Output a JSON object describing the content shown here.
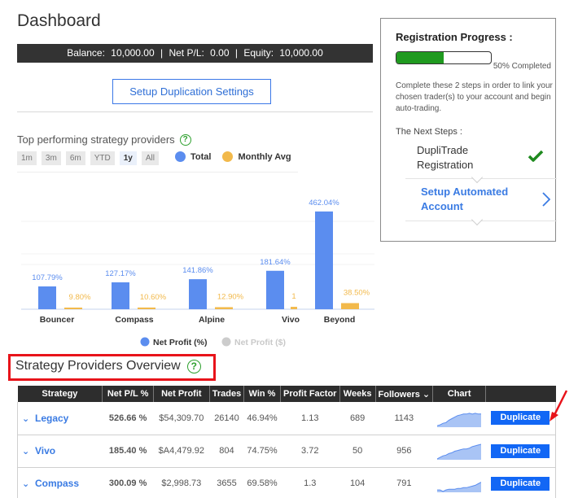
{
  "header": {
    "title": "Dashboard"
  },
  "balance_bar": {
    "balance_label": "Balance:",
    "balance_value": "10,000.00",
    "netpl_label": "Net P/L:",
    "netpl_value": "0.00",
    "equity_label": "Equity:",
    "equity_value": "10,000.00",
    "separator": "|"
  },
  "setup_button": {
    "label": "Setup Duplication Settings"
  },
  "top_providers": {
    "title": "Top performing strategy providers",
    "help_icon": "?",
    "ranges": [
      "1m",
      "3m",
      "6m",
      "YTD",
      "1y",
      "All"
    ],
    "active_range": "1y",
    "metric_legend": [
      {
        "label": "Total",
        "color": "#5b8def"
      },
      {
        "label": "Monthly Avg",
        "color": "#f2b94b"
      }
    ]
  },
  "chart_data": {
    "type": "bar",
    "title": "Top performing strategy providers",
    "categories": [
      "Bouncer",
      "Compass",
      "Alpine",
      "Vivo",
      "Beyond"
    ],
    "series": [
      {
        "name": "Total",
        "color": "#5b8def",
        "values": [
          107.79,
          127.17,
          141.86,
          181.64,
          462.04
        ],
        "labels": [
          "107.79%",
          "127.17%",
          "141.86%",
          "181.64%",
          "462.04%"
        ]
      },
      {
        "name": "Monthly Avg",
        "color": "#f2b94b",
        "values": [
          9.8,
          10.6,
          12.9,
          15.0,
          38.5
        ],
        "labels": [
          "9.80%",
          "10.60%",
          "12.90%",
          "1",
          "38.50%"
        ]
      }
    ],
    "ylim": [
      0,
      500
    ],
    "xlabel": "",
    "ylabel": "",
    "grid": true,
    "legend": [
      {
        "label": "Net Profit (%)",
        "color": "#5b8def",
        "active": true
      },
      {
        "label": "Net Profit ($)",
        "color": "#cccccc",
        "active": false
      }
    ],
    "legend_position": "bottom"
  },
  "registration": {
    "title": "Registration Progress :",
    "progress_percent": 50,
    "progress_label": "50% Completed",
    "description": "Complete these 2 steps in order to link your chosen trader(s) to your account and begin auto-trading.",
    "next_steps_label": "The Next Steps :",
    "steps": [
      {
        "line1": "DupliTrade",
        "line2": "Registration",
        "done": true
      },
      {
        "line1": "Setup Automated",
        "line2": "Account",
        "done": false
      }
    ]
  },
  "overview": {
    "title": "Strategy Providers Overview",
    "help_icon": "?",
    "columns": [
      "Strategy",
      "Net P/L %",
      "Net Profit",
      "Trades",
      "Win %",
      "Profit Factor",
      "Weeks",
      "Followers ⌄",
      "Chart",
      ""
    ],
    "rows": [
      {
        "strategy": "Legacy",
        "netpl": "526.66 %",
        "net_profit": "$54,309.70",
        "trades": "26140",
        "win": "46.94%",
        "profit_factor": "1.13",
        "weeks": "689",
        "followers": "1143",
        "spark": [
          2,
          3,
          5,
          6,
          9,
          11,
          13,
          15,
          16,
          17,
          17,
          18,
          17,
          18,
          17,
          17
        ],
        "action": "Duplicate"
      },
      {
        "strategy": "Vivo",
        "netpl": "185.40 %",
        "net_profit": "$A4,479.92",
        "trades": "804",
        "win": "74.75%",
        "profit_factor": "3.72",
        "weeks": "50",
        "followers": "956",
        "spark": [
          1,
          3,
          5,
          6,
          8,
          9,
          11,
          12,
          13,
          14,
          14,
          15,
          17,
          18,
          19,
          20
        ],
        "action": "Duplicate"
      },
      {
        "strategy": "Compass",
        "netpl": "300.09 %",
        "net_profit": "$2,998.73",
        "trades": "3655",
        "win": "69.58%",
        "profit_factor": "1.3",
        "weeks": "104",
        "followers": "791",
        "spark": [
          3,
          3,
          1,
          3,
          4,
          4,
          4,
          5,
          5,
          6,
          6,
          7,
          8,
          9,
          11,
          13
        ],
        "action": "Duplicate"
      }
    ],
    "expand_glyph": "⌄"
  }
}
